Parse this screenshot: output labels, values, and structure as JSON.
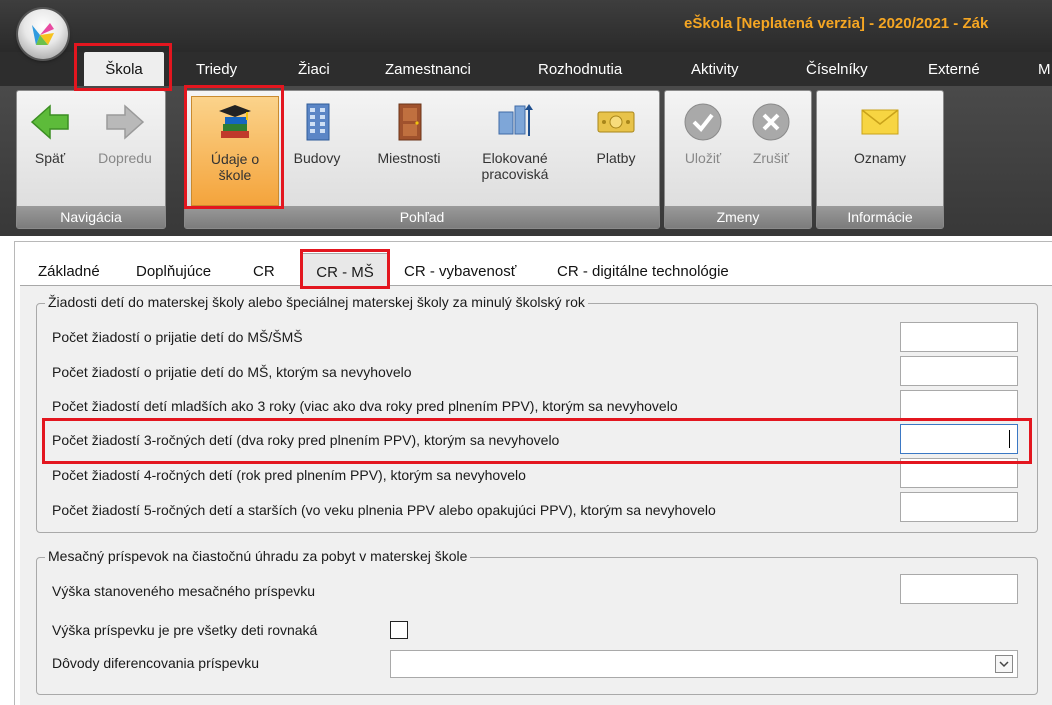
{
  "window": {
    "title": "eŠkola [Neplatená verzia] - 2020/2021 - Zák"
  },
  "ribbon_tabs": {
    "active": "Škola",
    "items": [
      "Triedy",
      "Žiaci",
      "Zamestnanci",
      "Rozhodnutia",
      "Aktivity",
      "Číselníky",
      "Externé",
      "M"
    ]
  },
  "ribbon": {
    "nav": {
      "label": "Navigácia",
      "back": "Späť",
      "forward": "Dopredu"
    },
    "view": {
      "label": "Pohľad",
      "school_info_1": "Údaje o",
      "school_info_2": "škole",
      "buildings": "Budovy",
      "rooms": "Miestnosti",
      "remote_1": "Elokované",
      "remote_2": "pracoviská",
      "payments": "Platby"
    },
    "changes": {
      "label": "Zmeny",
      "save": "Uložiť",
      "cancel": "Zrušiť"
    },
    "info": {
      "label": "Informácie",
      "notices": "Oznamy"
    }
  },
  "content_tabs": {
    "items": [
      "Základné",
      "Doplňujúce",
      "CR"
    ],
    "active": "CR - MŠ",
    "after": [
      "CR - vybavenosť",
      "CR - digitálne technológie"
    ]
  },
  "section1": {
    "legend": "Žiadosti detí do materskej školy alebo špeciálnej materskej školy za minulý školský rok",
    "rows": [
      "Počet žiadostí o prijatie detí do MŠ/ŠMŠ",
      "Počet žiadostí o prijatie detí do MŠ, ktorým sa nevyhovelo",
      "Počet žiadostí detí mladších ako 3 roky (viac ako dva roky pred plnením PPV), ktorým sa nevyhovelo",
      "Počet žiadostí 3-ročných detí (dva roky pred plnením PPV), ktorým sa nevyhovelo",
      "Počet žiadostí 4-ročných detí (rok pred plnením PPV), ktorým sa nevyhovelo",
      "Počet žiadostí 5-ročných detí a starších (vo veku plnenia PPV alebo opakujúci PPV), ktorým sa nevyhovelo"
    ]
  },
  "section2": {
    "legend": "Mesačný príspevok na čiastočnú úhradu za pobyt v materskej škole",
    "amount_label": "Výška stanoveného mesačného príspevku",
    "equal_label": "Výška príspevku je pre všetky deti rovnaká",
    "reasons_label": "Dôvody diferencovania príspevku"
  },
  "colors": {
    "highlight": "#e3161f",
    "title": "#f5a623"
  }
}
